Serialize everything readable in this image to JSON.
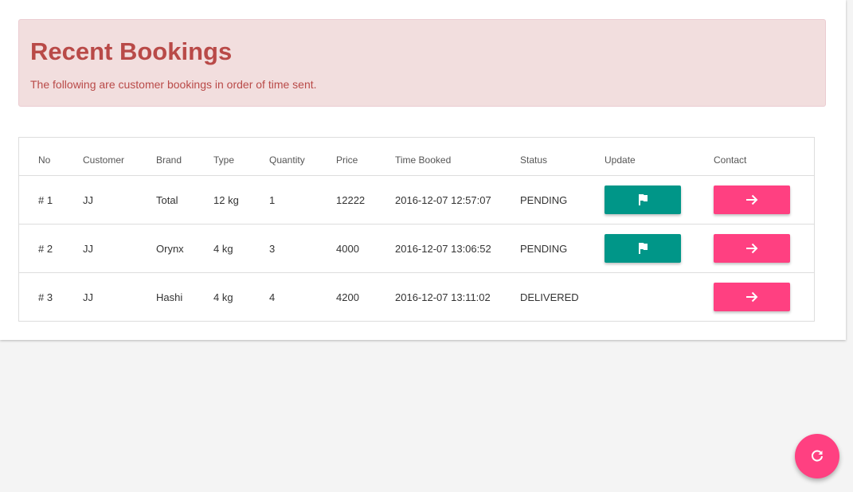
{
  "header": {
    "title": "Recent Bookings",
    "subtitle": "The following are customer bookings in order of time sent."
  },
  "table": {
    "columns": [
      "No",
      "Customer",
      "Brand",
      "Type",
      "Quantity",
      "Price",
      "Time Booked",
      "Status",
      "Update",
      "Contact"
    ],
    "rows": [
      {
        "no": "# 1",
        "customer": "JJ",
        "brand": "Total",
        "type": "12 kg",
        "quantity": "1",
        "price": "12222",
        "time": "2016-12-07 12:57:07",
        "status": "PENDING",
        "update_icon": "flag-icon",
        "contact_icon": "arrow-right-icon"
      },
      {
        "no": "# 2",
        "customer": "JJ",
        "brand": "Orynx",
        "type": "4 kg",
        "quantity": "3",
        "price": "4000",
        "time": "2016-12-07 13:06:52",
        "status": "PENDING",
        "update_icon": "flag-icon",
        "contact_icon": "arrow-right-icon"
      },
      {
        "no": "# 3",
        "customer": "JJ",
        "brand": "Hashi",
        "type": "4 kg",
        "quantity": "4",
        "price": "4200",
        "time": "2016-12-07 13:11:02",
        "status": "DELIVERED",
        "contact_icon": "arrow-right-icon"
      }
    ]
  },
  "fab": {
    "icon": "refresh-icon"
  },
  "colors": {
    "alert_bg": "#f2dede",
    "alert_text": "#b94a48",
    "update_button": "#009688",
    "contact_button": "#ff4081",
    "page_bg": "#f4f4f4"
  }
}
